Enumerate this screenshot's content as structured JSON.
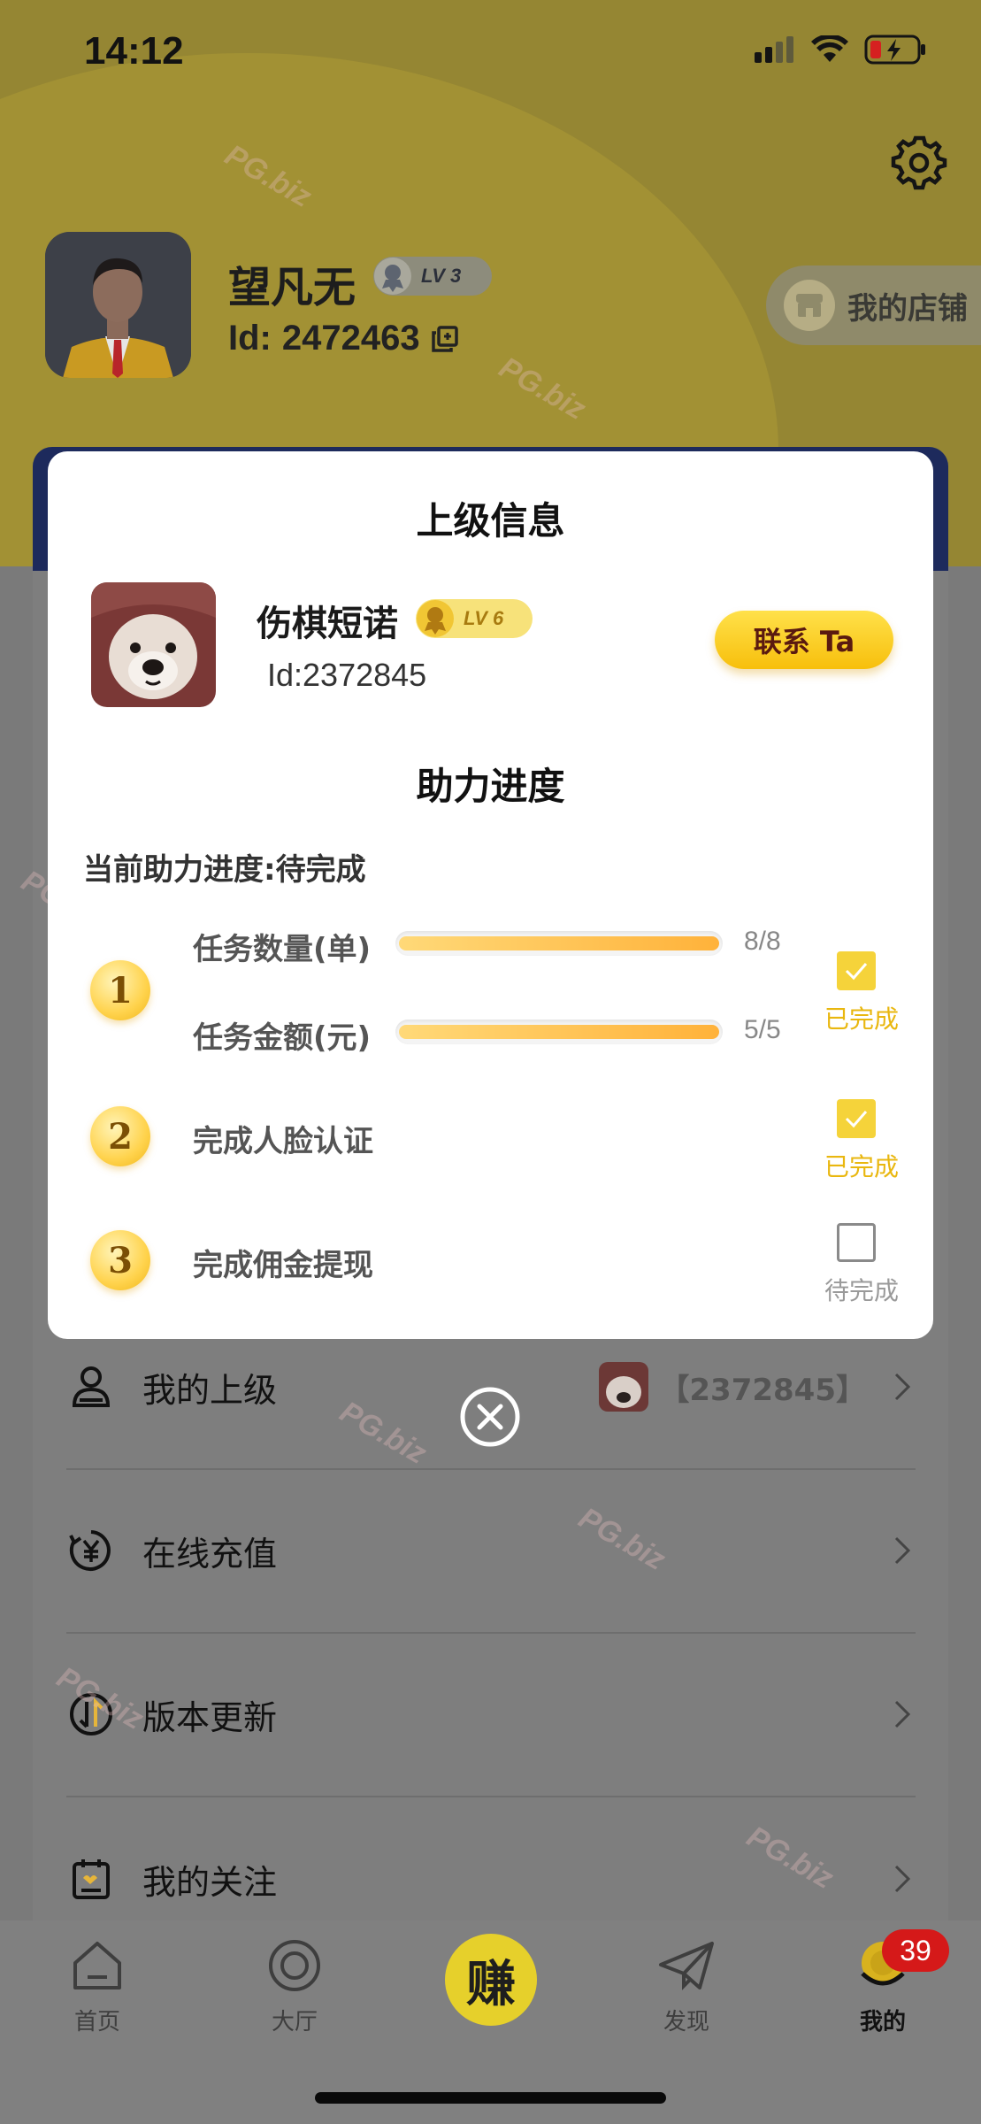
{
  "status_bar": {
    "time": "14:12"
  },
  "profile": {
    "name": "望凡无",
    "level": "LV 3",
    "id_label": "Id:",
    "id_value": "2472463",
    "shop_label": "我的店铺"
  },
  "modal": {
    "title": "上级信息",
    "superior": {
      "name": "伤棋短诺",
      "level": "LV 6",
      "id": "Id:2372845",
      "contact_label": "联系 Ta"
    },
    "progress_title": "助力进度",
    "progress_status": "当前助力进度:待完成",
    "steps": [
      {
        "number": "1",
        "rows": [
          {
            "label": "任务数量(单)",
            "count": "8/8",
            "fraction": 1.0
          },
          {
            "label": "任务金额(元)",
            "count": "5/5",
            "fraction": 1.0
          }
        ],
        "status": "已完成",
        "done": true
      },
      {
        "number": "2",
        "label": "完成人脸认证",
        "status": "已完成",
        "done": true
      },
      {
        "number": "3",
        "label": "完成佣金提现",
        "status": "待完成",
        "done": false
      }
    ]
  },
  "menu": {
    "items": [
      {
        "label": "我的上级",
        "value": "【2372845】"
      },
      {
        "label": "在线充值"
      },
      {
        "label": "版本更新"
      },
      {
        "label": "我的关注"
      }
    ]
  },
  "tabbar": {
    "tabs": [
      {
        "label": "首页"
      },
      {
        "label": "大厅"
      },
      {
        "label": "赚"
      },
      {
        "label": "发现"
      },
      {
        "label": "我的"
      }
    ],
    "badge": "39"
  },
  "watermark": "PG.biz",
  "colors": {
    "accent_yellow": "#f7bf0c",
    "done_yellow": "#e9b70f",
    "badge_red": "#d51919"
  }
}
